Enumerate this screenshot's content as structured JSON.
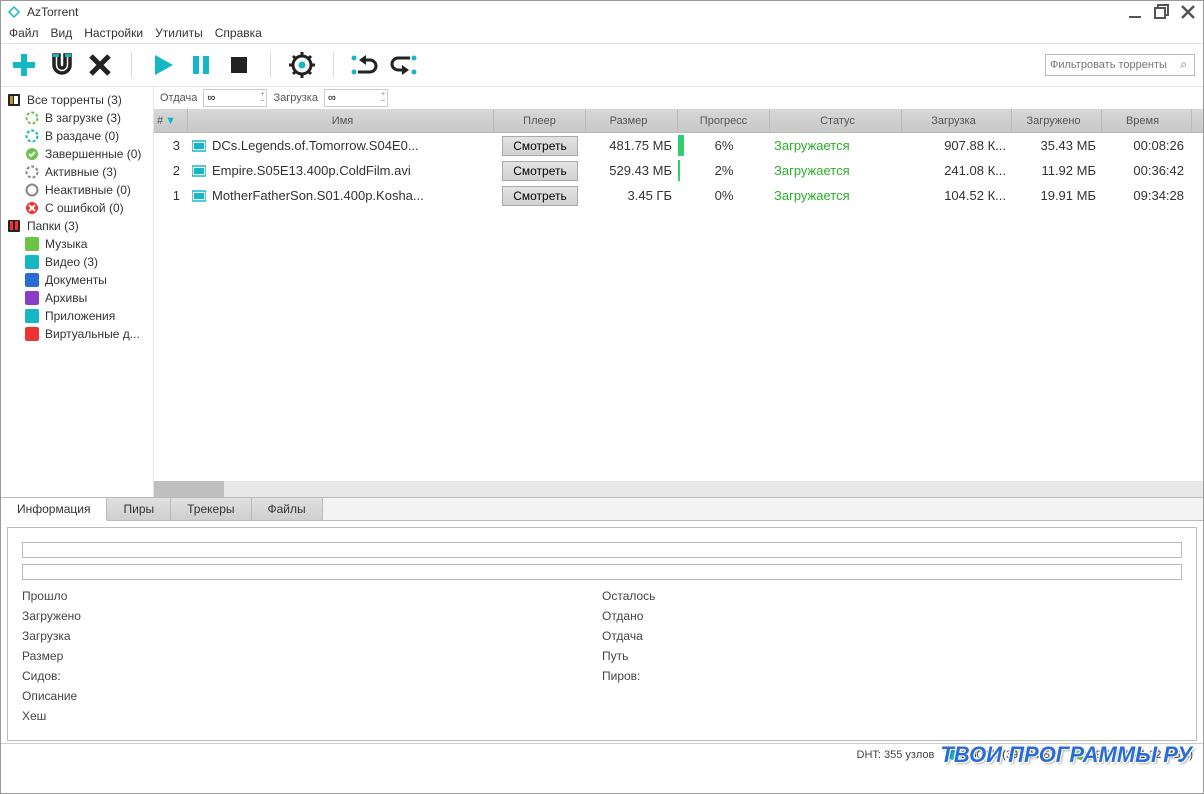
{
  "app": {
    "title": "AzTorrent"
  },
  "menu": [
    "Файл",
    "Вид",
    "Настройки",
    "Утилиты",
    "Справка"
  ],
  "filter_placeholder": "Фильтровать торренты",
  "limits": {
    "upload_label": "Отдача",
    "upload_value": "∞",
    "download_label": "Загрузка",
    "download_value": "∞"
  },
  "sidebar": {
    "all": "Все торренты (3)",
    "downloading": "В загрузке (3)",
    "seeding": "В раздаче (0)",
    "completed": "Завершенные (0)",
    "active": "Активные (3)",
    "inactive": "Неактивные (0)",
    "error": "С ошибкой (0)",
    "folders": "Папки (3)",
    "music": "Музыка",
    "video": "Видео (3)",
    "docs": "Документы",
    "archives": "Архивы",
    "apps": "Приложения",
    "vd": "Виртуальные д..."
  },
  "columns": {
    "num": "#",
    "name": "Имя",
    "player": "Плеер",
    "size": "Размер",
    "progress": "Прогресс",
    "status": "Статус",
    "download": "Загрузка",
    "downloaded": "Загружено",
    "time": "Время"
  },
  "watch_label": "Смотреть",
  "rows": [
    {
      "num": "3",
      "name": "DCs.Legends.of.Tomorrow.S04E0...",
      "size": "481.75 МБ",
      "progress": "6%",
      "progress_pct": 6,
      "status": "Загружается",
      "dl": "907.88 К...",
      "done": "35.43 МБ",
      "time": "00:08:26"
    },
    {
      "num": "2",
      "name": "Empire.S05E13.400p.ColdFilm.avi",
      "size": "529.43 МБ",
      "progress": "2%",
      "progress_pct": 2,
      "status": "Загружается",
      "dl": "241.08 К...",
      "done": "11.92 МБ",
      "time": "00:36:42"
    },
    {
      "num": "1",
      "name": "MotherFatherSon.S01.400p.Kosha...",
      "size": "3.45 ГБ",
      "progress": "0%",
      "progress_pct": 0,
      "status": "Загружается",
      "dl": "104.52 К...",
      "done": "19.91 МБ",
      "time": "09:34:28"
    }
  ],
  "tabs": [
    "Информация",
    "Пиры",
    "Трекеры",
    "Файлы"
  ],
  "info_left": [
    "Прошло",
    "Загружено",
    "Загрузка",
    "Размер",
    "Сидов:",
    "Описание",
    "Хеш"
  ],
  "info_right": [
    "Осталось",
    "Отдано",
    "Отдача",
    "Путь",
    "Пиров:"
  ],
  "status": {
    "dht": "DHT: 355 узлов",
    "down": "2.30 МБ(39.09 КБ\\с)",
    "up": "69.53 МБ(1.22 МБ\\с)"
  },
  "watermark": "ТВОИ ПРОГРАММЫ РУ",
  "colors": {
    "teal": "#14b8c4",
    "green_status": "#28b028",
    "blue_dot": "#1fb5d1",
    "green_dot": "#6cc24a"
  }
}
